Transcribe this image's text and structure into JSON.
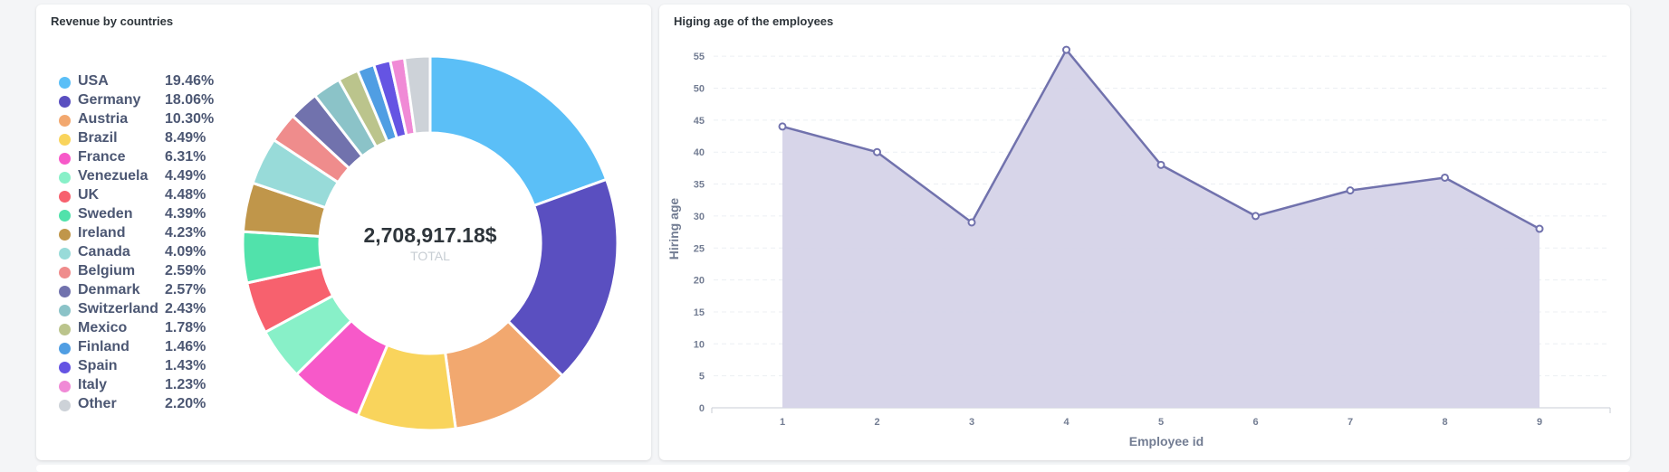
{
  "revenue_card": {
    "title": "Revenue by countries",
    "total_value": "2,708,917.18$",
    "total_label": "TOTAL"
  },
  "hiring_card": {
    "title": "Higing age of the employees"
  },
  "chart_data": [
    {
      "type": "pie",
      "variant": "donut",
      "title": "Revenue by countries",
      "categories": [
        "USA",
        "Germany",
        "Austria",
        "Brazil",
        "France",
        "Venezuela",
        "UK",
        "Sweden",
        "Ireland",
        "Canada",
        "Belgium",
        "Denmark",
        "Switzerland",
        "Mexico",
        "Finland",
        "Spain",
        "Italy",
        "Other"
      ],
      "values": [
        19.46,
        18.06,
        10.3,
        8.49,
        6.31,
        4.49,
        4.48,
        4.39,
        4.23,
        4.09,
        2.59,
        2.57,
        2.43,
        1.78,
        1.46,
        1.43,
        1.23,
        2.2
      ],
      "labels": [
        "19.46%",
        "18.06%",
        "10.30%",
        "8.49%",
        "6.31%",
        "4.49%",
        "4.48%",
        "4.39%",
        "4.23%",
        "4.09%",
        "2.59%",
        "2.57%",
        "2.43%",
        "1.78%",
        "1.46%",
        "1.43%",
        "1.23%",
        "2.20%"
      ],
      "colors": [
        "#5bbff7",
        "#5a4fc0",
        "#f2a86f",
        "#f9d45c",
        "#f759c9",
        "#88f0c8",
        "#f7616e",
        "#51e2ab",
        "#c0964a",
        "#98dbd9",
        "#ef8c8c",
        "#7172ad",
        "#8bc3c8",
        "#bbc48c",
        "#509ee3",
        "#6554e3",
        "#f08ad6",
        "#cdd2d8"
      ],
      "legend_position": "left",
      "center_value": "2,708,917.18$",
      "center_label": "TOTAL"
    },
    {
      "type": "area",
      "title": "Higing age of the employees",
      "xlabel": "Employee id",
      "ylabel": "Hiring age",
      "x": [
        1,
        2,
        3,
        4,
        5,
        6,
        7,
        8,
        9
      ],
      "series": [
        {
          "values": [
            44,
            40,
            29,
            56,
            38,
            30,
            34,
            36,
            28
          ]
        }
      ],
      "ylim": [
        0,
        55
      ],
      "yticks": [
        0,
        5,
        10,
        15,
        20,
        25,
        30,
        35,
        40,
        45,
        50,
        55
      ],
      "grid": true,
      "line_color": "#7172ad",
      "fill_color": "#d5d3e8"
    }
  ]
}
